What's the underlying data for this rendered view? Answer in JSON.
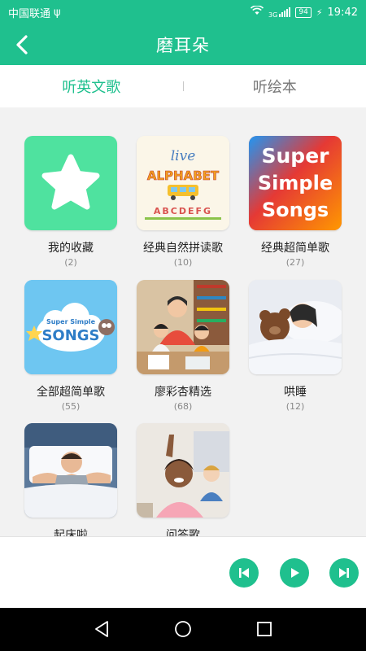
{
  "status": {
    "carrier": "中国联通",
    "usb_glyph": "ψ",
    "network": "3G",
    "battery": "94",
    "time": "19:42"
  },
  "header": {
    "title": "磨耳朵"
  },
  "tabs": [
    {
      "label": "听英文歌",
      "active": true
    },
    {
      "label": "听绘本",
      "active": false
    }
  ],
  "albums": [
    {
      "name": "我的收藏",
      "count": "(2)"
    },
    {
      "name": "经典自然拼读歌",
      "count": "(10)",
      "art_text_1": "live",
      "art_text_2": "ALPHABET",
      "art_letters": "ABCDEFG"
    },
    {
      "name": "经典超简单歌",
      "count": "(27)",
      "art_lines": [
        "Super",
        "Simple",
        "Songs"
      ]
    },
    {
      "name": "全部超简单歌",
      "count": "(55)",
      "art_small": "Super Simple",
      "art_big": "SONGS"
    },
    {
      "name": "廖彩杏精选",
      "count": "(68)"
    },
    {
      "name": "哄睡",
      "count": "(12)"
    },
    {
      "name": "起床啦",
      "count": ""
    },
    {
      "name": "问答歌",
      "count": ""
    }
  ],
  "colors": {
    "accent": "#1fc08e",
    "favorite_tile": "#4fe29f"
  },
  "icons": {
    "back": "chevron-left-icon",
    "previous": "skip-previous-icon",
    "play": "play-icon",
    "next": "skip-next-icon",
    "nav_back": "triangle-back-icon",
    "nav_home": "circle-home-icon",
    "nav_recents": "square-recents-icon"
  }
}
